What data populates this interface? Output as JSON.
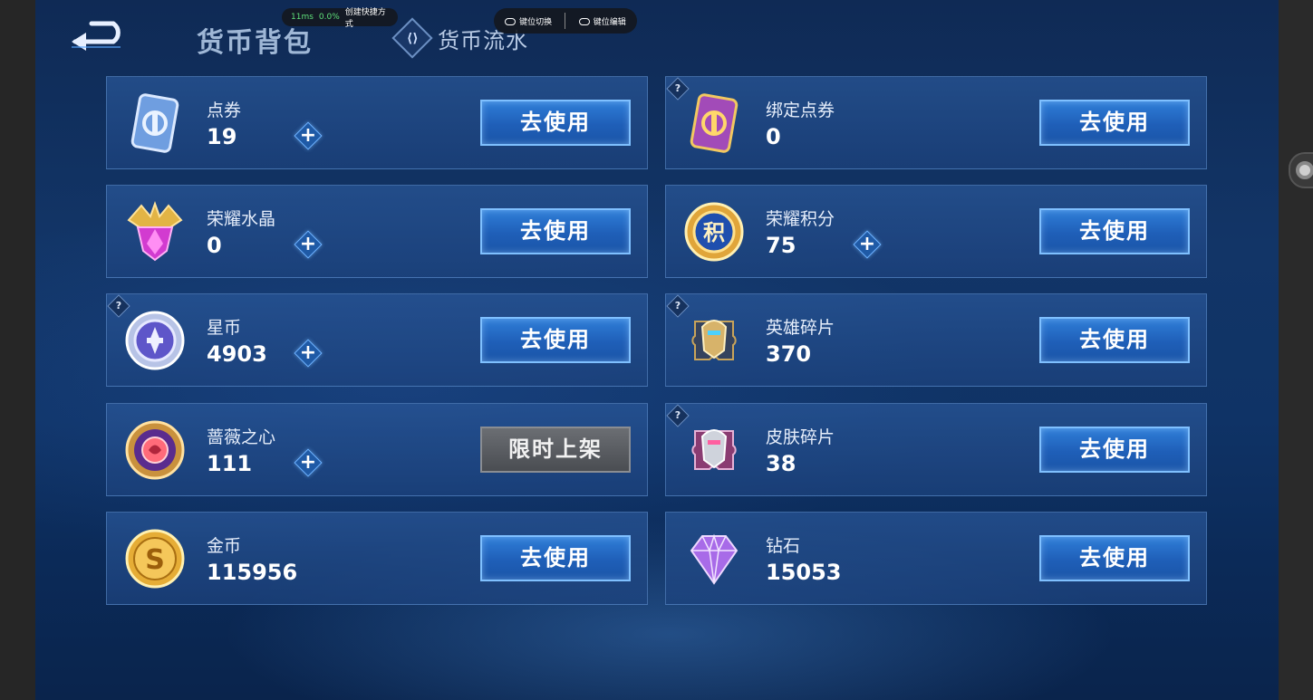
{
  "header": {
    "back_label": "",
    "active_tab": "货币背包",
    "flow_tab": "货币流水",
    "flow_tab_icon": "exchange-icon"
  },
  "overlay": {
    "latency": "11ms",
    "loss": "0.0%",
    "shortcut": "创建快捷方式",
    "key_switch": "键位切换",
    "key_edit": "键位编辑"
  },
  "currencies": [
    {
      "name": "点券",
      "count": "19",
      "action": "去使用",
      "has_plus": true,
      "has_help": false,
      "icon": "voucher-icon"
    },
    {
      "name": "绑定点券",
      "count": "0",
      "action": "去使用",
      "has_plus": false,
      "has_help": true,
      "icon": "bound-voucher-icon"
    },
    {
      "name": "荣耀水晶",
      "count": "0",
      "action": "去使用",
      "has_plus": true,
      "has_help": false,
      "icon": "glory-crystal-icon"
    },
    {
      "name": "荣耀积分",
      "count": "75",
      "action": "去使用",
      "has_plus": true,
      "has_help": false,
      "icon": "glory-points-icon"
    },
    {
      "name": "星币",
      "count": "4903",
      "action": "去使用",
      "has_plus": true,
      "has_help": true,
      "icon": "star-coin-icon"
    },
    {
      "name": "英雄碎片",
      "count": "370",
      "action": "去使用",
      "has_plus": false,
      "has_help": true,
      "icon": "hero-fragment-icon"
    },
    {
      "name": "蔷薇之心",
      "count": "111",
      "action": "限时上架",
      "has_plus": true,
      "has_help": false,
      "icon": "rose-heart-icon"
    },
    {
      "name": "皮肤碎片",
      "count": "38",
      "action": "去使用",
      "has_plus": false,
      "has_help": true,
      "icon": "skin-fragment-icon"
    },
    {
      "name": "金币",
      "count": "115956",
      "action": "去使用",
      "has_plus": false,
      "has_help": false,
      "icon": "gold-coin-icon"
    },
    {
      "name": "钻石",
      "count": "15053",
      "action": "去使用",
      "has_plus": false,
      "has_help": false,
      "icon": "diamond-icon"
    }
  ],
  "plus_glyph": "+",
  "help_glyph": "?"
}
